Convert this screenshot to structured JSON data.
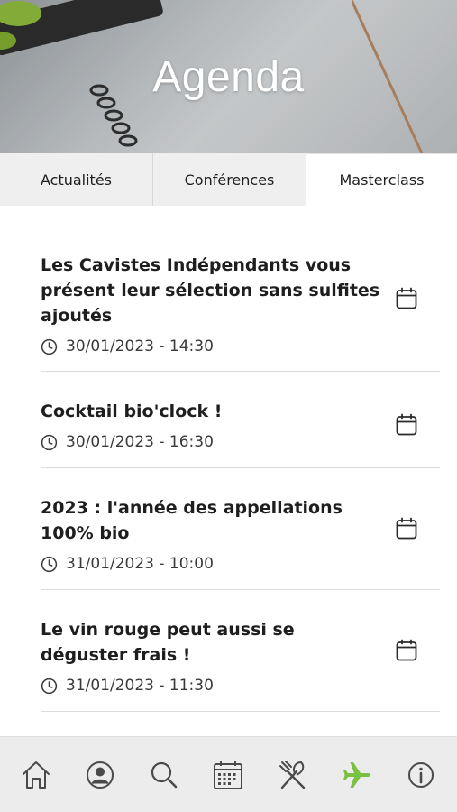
{
  "header": {
    "title": "Agenda"
  },
  "tabs": [
    {
      "label": "Actualités",
      "active": false
    },
    {
      "label": "Conférences",
      "active": false
    },
    {
      "label": "Masterclass",
      "active": true
    }
  ],
  "events": [
    {
      "title": "Les Cavistes Indépendants vous présent leur sélection sans sulfites ajoutés",
      "datetime": "30/01/2023 - 14:30"
    },
    {
      "title": "Cocktail bio'clock !",
      "datetime": "30/01/2023 - 16:30"
    },
    {
      "title": "2023 : l'année des appellations 100% bio",
      "datetime": "31/01/2023 - 10:00"
    },
    {
      "title": "Le vin rouge peut aussi se déguster frais !",
      "datetime": "31/01/2023 - 11:30"
    }
  ],
  "bottom_nav": [
    {
      "icon": "home-icon",
      "active": false
    },
    {
      "icon": "user-icon",
      "active": false
    },
    {
      "icon": "search-icon",
      "active": false
    },
    {
      "icon": "calendar-icon",
      "active": false
    },
    {
      "icon": "restaurant-icon",
      "active": false
    },
    {
      "icon": "airplane-icon",
      "active": true
    },
    {
      "icon": "info-icon",
      "active": false
    }
  ],
  "colors": {
    "nav_icon": "#4a4a4a",
    "nav_active": "#7ac143",
    "text": "#1e1e1e"
  }
}
